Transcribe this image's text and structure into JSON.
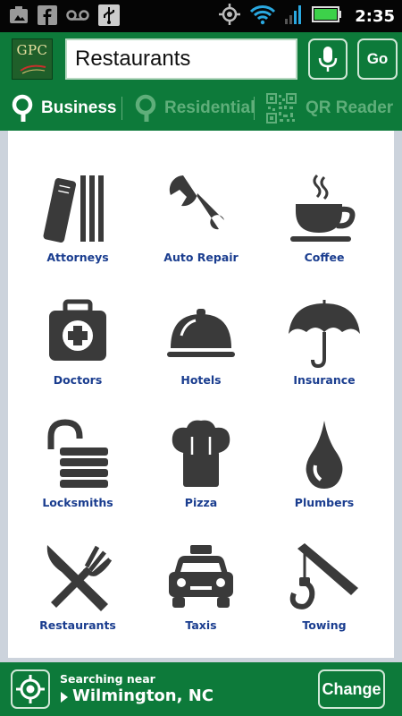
{
  "status_bar": {
    "time": "2:35",
    "icons": [
      "image-icon",
      "facebook-icon",
      "voicemail-icon",
      "usb-icon",
      "gps-icon",
      "wifi-icon",
      "signal-icon",
      "battery-icon"
    ]
  },
  "header": {
    "logo_text": "GPC",
    "search_value": "Restaurants",
    "go_label": "Go"
  },
  "tabs": [
    {
      "label": "Business",
      "active": true
    },
    {
      "label": "Residential",
      "active": false
    },
    {
      "label": "QR Reader",
      "active": false
    }
  ],
  "categories": [
    {
      "label": "Attorneys",
      "icon": "books-icon"
    },
    {
      "label": "Auto Repair",
      "icon": "wrench-icon"
    },
    {
      "label": "Coffee",
      "icon": "coffee-cup-icon"
    },
    {
      "label": "Doctors",
      "icon": "first-aid-kit-icon"
    },
    {
      "label": "Hotels",
      "icon": "service-bell-icon"
    },
    {
      "label": "Insurance",
      "icon": "umbrella-icon"
    },
    {
      "label": "Locksmiths",
      "icon": "padlock-icon"
    },
    {
      "label": "Pizza",
      "icon": "chef-hat-icon"
    },
    {
      "label": "Plumbers",
      "icon": "water-drop-icon"
    },
    {
      "label": "Restaurants",
      "icon": "knife-fork-icon"
    },
    {
      "label": "Taxis",
      "icon": "taxi-icon"
    },
    {
      "label": "Towing",
      "icon": "tow-hook-icon"
    }
  ],
  "footer": {
    "near_label": "Searching near",
    "city": "Wilmington, NC",
    "change_label": "Change"
  },
  "colors": {
    "brand_green": "#0d7a3a",
    "inactive_tab": "#5fae7a",
    "label_blue": "#1a3d8f",
    "icon_gray": "#3a3a3a"
  }
}
